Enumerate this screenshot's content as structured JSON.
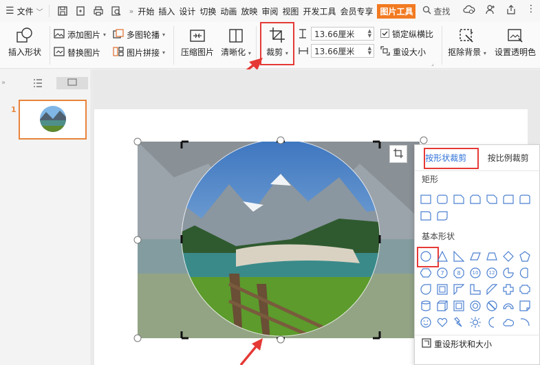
{
  "menu": {
    "file_label": "文件",
    "tabs": [
      "开始",
      "插入",
      "设计",
      "切换",
      "动画",
      "放映",
      "审阅",
      "视图",
      "开发工具",
      "会员专享",
      "图片工具"
    ],
    "search_label": "查找"
  },
  "ribbon": {
    "insert_shape": "插入形状",
    "add_picture": "添加图片",
    "replace_picture": "替换图片",
    "multi_carousel": "多图轮播",
    "picture_collage": "图片拼接",
    "compress_picture": "压缩图片",
    "sharpen": "清晰化",
    "crop": "裁剪",
    "height_value": "13.66厘米",
    "width_value": "13.66厘米",
    "lock_ratio": "锁定纵横比",
    "reset_size": "重设大小",
    "remove_bg": "抠除背景",
    "set_transparent": "设置透明色"
  },
  "slides_panel": {
    "slide_number": "1"
  },
  "crop_dropdown": {
    "tab_shape": "按形状裁剪",
    "tab_ratio": "按比例裁剪",
    "section_rect": "矩形",
    "section_basic": "基本形状",
    "basic_labels": [
      "7",
      "8",
      "10",
      "12"
    ],
    "reset_label": "重设形状和大小"
  },
  "colors": {
    "accent_orange": "#f27a21",
    "highlight_red": "#e53935",
    "link_blue": "#2b6fd8"
  }
}
